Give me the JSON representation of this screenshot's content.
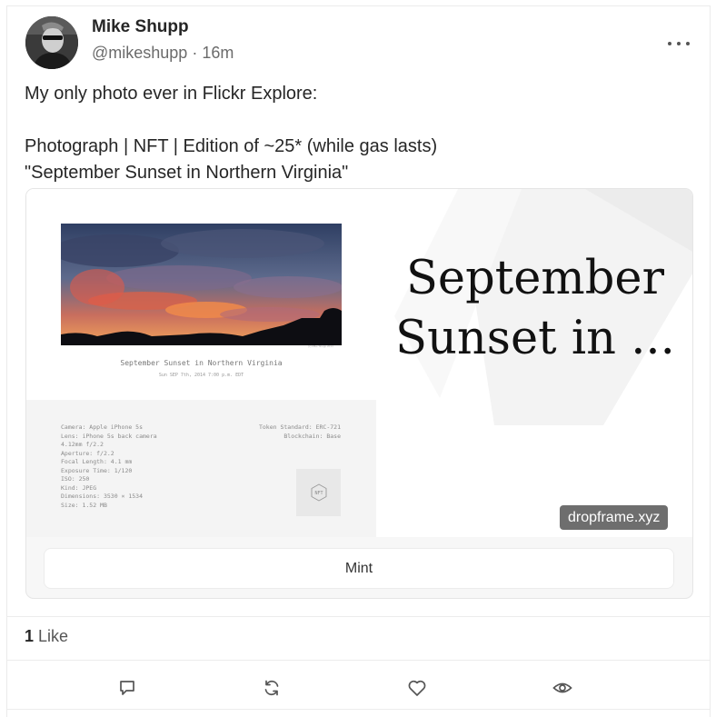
{
  "author": {
    "name": "Mike Shupp",
    "handle": "@mikeshupp",
    "separator": "·",
    "time": "16m"
  },
  "post": {
    "text": "My only photo ever in Flickr Explore:\n\nPhotograph | NFT | Edition of ~25* (while gas lasts)\n\"September Sunset in Northern Virginia\""
  },
  "embed": {
    "title": "September Sunset in ...",
    "domain": "dropframe.xyz",
    "mint_label": "Mint",
    "artwork": {
      "title": "September Sunset in Northern Virginia",
      "subtitle": "Sun SEP 7th, 2014 7:00 p.m. EDT",
      "credit": "(c) Mike Shupp 2014",
      "details": [
        "Camera: Apple iPhone 5s",
        "Lens: iPhone 5s back camera",
        "4.12mm f/2.2",
        "Aperture: f/2.2",
        "Focal Length: 4.1 mm",
        "Exposure Time: 1/120",
        "ISO: 250",
        "Kind: JPEG",
        "Dimensions: 3530 × 1534",
        "Size: 1.52 MB"
      ],
      "token": [
        "Token Standard: ERC-721",
        "Blockchain: Base"
      ],
      "nft_badge": "NFT"
    }
  },
  "stats": {
    "like_count": "1",
    "like_label": "Like"
  },
  "actions": [
    "comment-icon",
    "repost-icon",
    "like-icon",
    "view-icon"
  ],
  "colors": {
    "text": "#262626",
    "muted": "#6b6b6b",
    "badge_bg": "#6e6e6e"
  }
}
